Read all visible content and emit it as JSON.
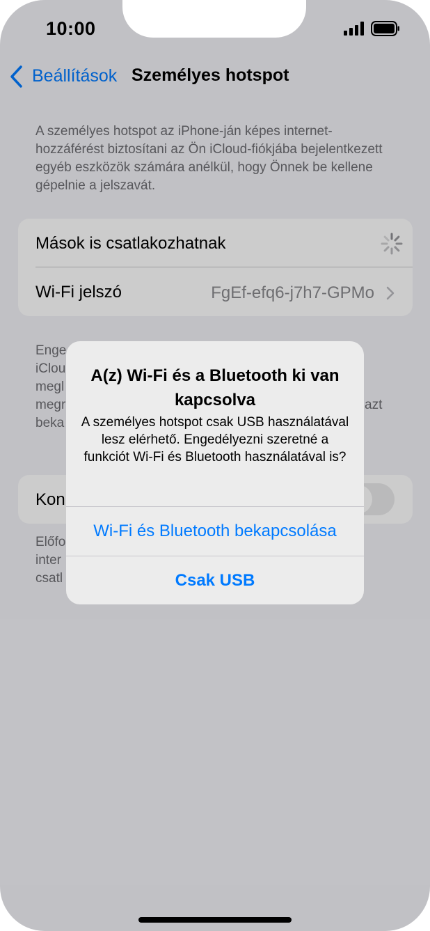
{
  "status_bar": {
    "time": "10:00"
  },
  "nav": {
    "back_label": "Beállítások",
    "title": "Személyes hotspot"
  },
  "description_top": "A személyes hotspot az iPhone-ján képes internet-hozzáférést biztosítani az Ön iCloud-fiókjába bejelentkezett egyéb eszközök számára anélkül, hogy Önnek be kellene gépelnie a jelszavát.",
  "settings": {
    "allow_others": {
      "label": "Mások is csatlakozhatnak",
      "state": "loading"
    },
    "wifi_password": {
      "label": "Wi-Fi jelszó",
      "value": "FgEf-efq6-j7h7-GPMo"
    }
  },
  "obscured_text": {
    "desc_middle_lines": [
      "Enge",
      "iClou",
      "megl",
      "megr",
      "beka"
    ],
    "desc_middle_tail": "azt",
    "row2_label": "Kon",
    "desc_bottom_lines": [
      "Előfo",
      "inter",
      "csatl"
    ]
  },
  "alert": {
    "title": "A(z) Wi-Fi és a Bluetooth ki van kapcsolva",
    "message": "A személyes hotspot csak USB használatával lesz elérhető. Engedélyezni szeretné a funkciót Wi-Fi és Bluetooth használatával is?",
    "buttons": [
      "Wi-Fi és Bluetooth bekapcsolása",
      "Csak USB"
    ]
  },
  "colors": {
    "accent": "#007aff",
    "background": "#f2f2f7",
    "secondary_text": "#6d6d72"
  }
}
